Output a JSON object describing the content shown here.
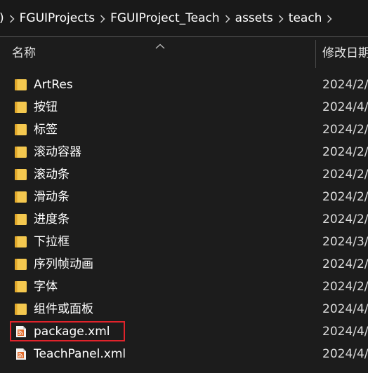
{
  "breadcrumb": {
    "lead": ")",
    "items": [
      "FGUIProjects",
      "FGUIProject_Teach",
      "assets",
      "teach"
    ]
  },
  "columns": {
    "name": "名称",
    "date": "修改日期"
  },
  "files": [
    {
      "name": "ArtRes",
      "date": "2024/2/",
      "type": "folder"
    },
    {
      "name": "按钮",
      "date": "2024/4/",
      "type": "folder"
    },
    {
      "name": "标签",
      "date": "2024/2/",
      "type": "folder"
    },
    {
      "name": "滚动容器",
      "date": "2024/2/",
      "type": "folder"
    },
    {
      "name": "滚动条",
      "date": "2024/2/",
      "type": "folder"
    },
    {
      "name": "滑动条",
      "date": "2024/2/",
      "type": "folder"
    },
    {
      "name": "进度条",
      "date": "2024/2/",
      "type": "folder"
    },
    {
      "name": "下拉框",
      "date": "2024/3/",
      "type": "folder"
    },
    {
      "name": "序列帧动画",
      "date": "2024/2/",
      "type": "folder"
    },
    {
      "name": "字体",
      "date": "2024/2/",
      "type": "folder"
    },
    {
      "name": "组件或面板",
      "date": "2024/4/",
      "type": "folder"
    },
    {
      "name": "package.xml",
      "date": "2024/4/",
      "type": "xml"
    },
    {
      "name": "TeachPanel.xml",
      "date": "2024/4/",
      "type": "xml"
    }
  ],
  "colors": {
    "background": "#1c1c1c",
    "folder": "#f4c84f",
    "xml_icon": "#e06a2a",
    "highlight": "#e0232b"
  }
}
